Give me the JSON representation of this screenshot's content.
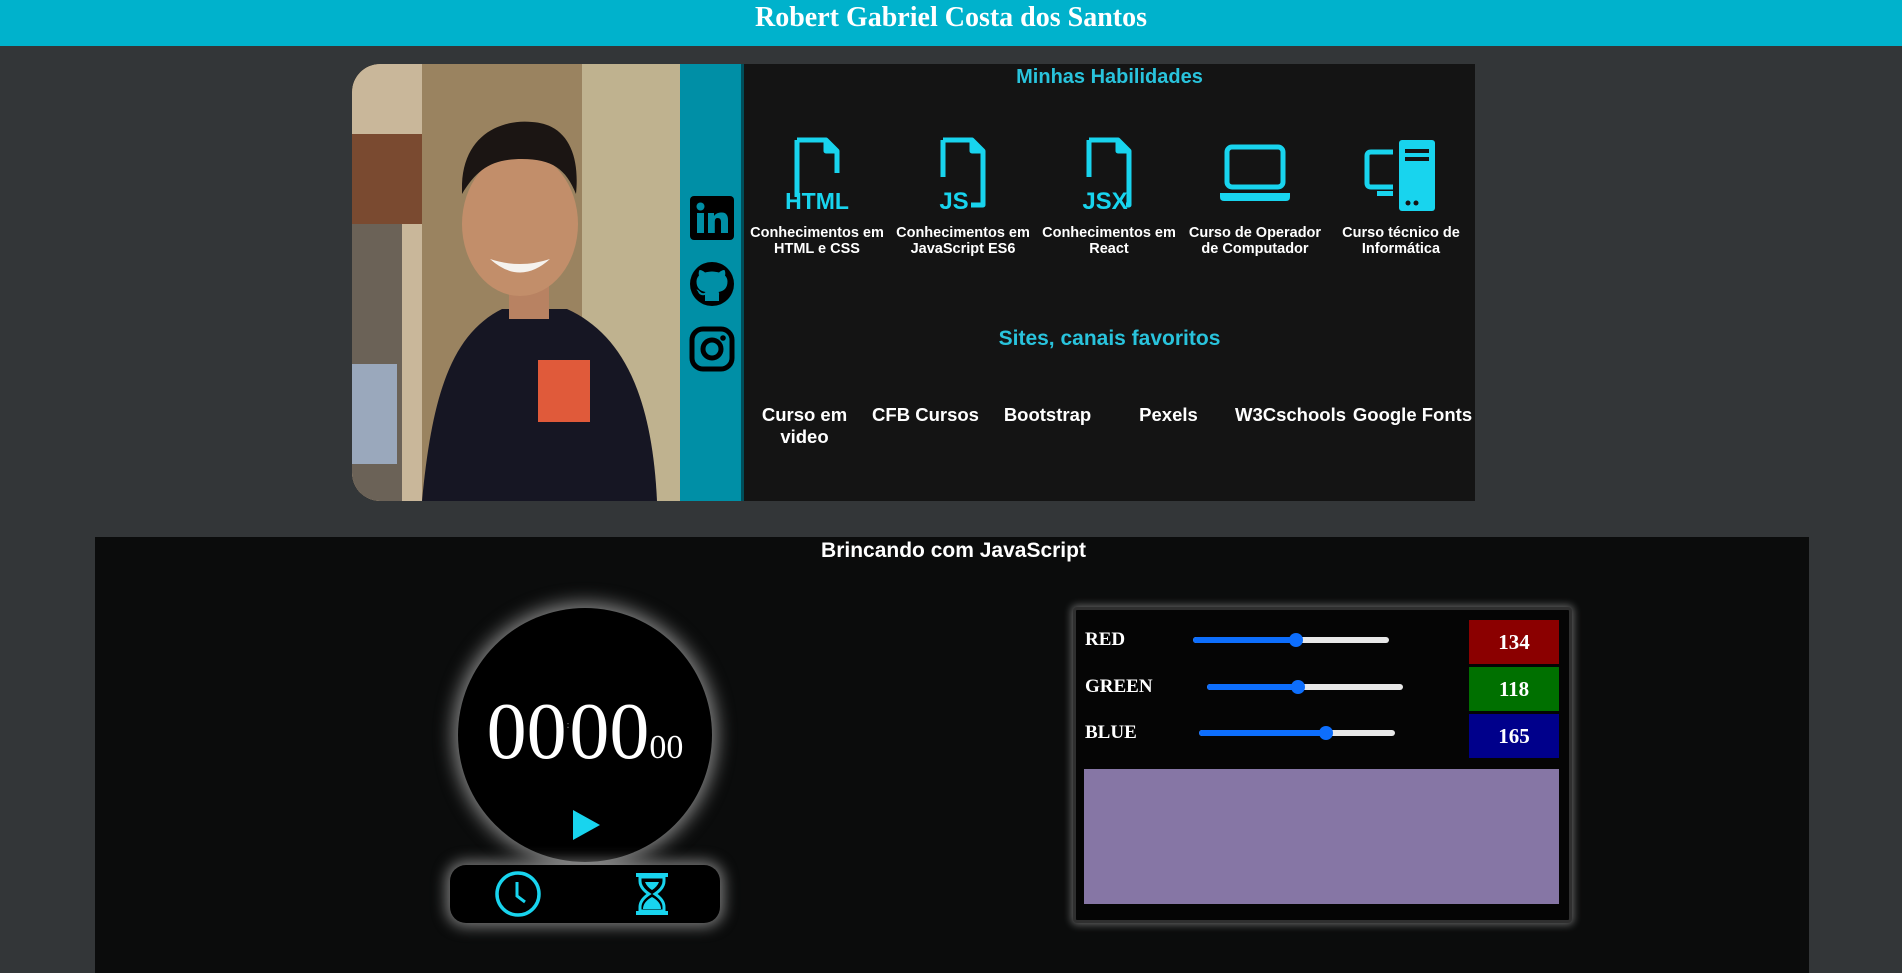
{
  "header": {
    "title": "Robert Gabriel Costa dos Santos"
  },
  "profile": {
    "photo_alt": "Foto de perfil",
    "socials": [
      {
        "name": "linkedin-icon"
      },
      {
        "name": "github-icon"
      },
      {
        "name": "instagram-icon"
      }
    ]
  },
  "skills": {
    "title": "Minhas Habilidades",
    "items": [
      {
        "icon": "html-file-icon",
        "badge": "HTML",
        "label": "Conhecimentos em HTML e CSS"
      },
      {
        "icon": "js-file-icon",
        "badge": "JS",
        "label": "Conhecimentos em JavaScript ES6"
      },
      {
        "icon": "jsx-file-icon",
        "badge": "JSX",
        "label": "Conhecimentos em React"
      },
      {
        "icon": "laptop-icon",
        "label": "Curso de Operador de Computador"
      },
      {
        "icon": "desktop-computer-icon",
        "label": "Curso técnico de Informática"
      }
    ]
  },
  "sites": {
    "title": "Sites, canais favoritos",
    "items": [
      {
        "label": "Curso em video"
      },
      {
        "label": "CFB Cursos"
      },
      {
        "label": "Bootstrap"
      },
      {
        "label": "Pexels"
      },
      {
        "label": "W3Cschools"
      },
      {
        "label": "Google Fonts"
      }
    ]
  },
  "playground": {
    "title": "Brincando com JavaScript",
    "stopwatch": {
      "minutes": "00",
      "separator": ":",
      "seconds": "00",
      "centiseconds": "00",
      "play_icon": "play-icon",
      "modes": [
        "clock-icon",
        "hourglass-icon"
      ]
    },
    "color_mixer": {
      "max": 255,
      "channels": [
        {
          "key": "red",
          "label": "RED",
          "value": "134",
          "swatch": "#8b0000"
        },
        {
          "key": "green",
          "label": "GREEN",
          "value": "118",
          "swatch": "#007000"
        },
        {
          "key": "blue",
          "label": "BLUE",
          "value": "165",
          "swatch": "#00008b"
        }
      ],
      "preview_color": "#8676a5"
    }
  },
  "colors": {
    "accent": "#00b2cc",
    "accent_dark": "#008fa6",
    "icon": "#18d4ee",
    "page_bg": "#333638"
  }
}
